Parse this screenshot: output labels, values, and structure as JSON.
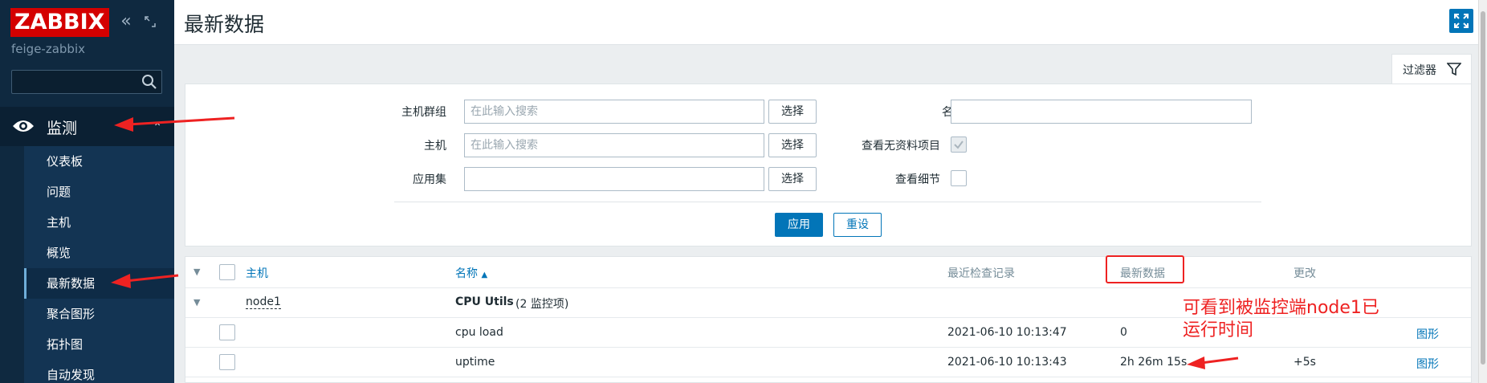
{
  "app": {
    "logo": "ZABBIX",
    "subtitle": "feige-zabbix"
  },
  "sidebar": {
    "section": "监测",
    "items": [
      {
        "label": "仪表板"
      },
      {
        "label": "问题"
      },
      {
        "label": "主机"
      },
      {
        "label": "概览"
      },
      {
        "label": "最新数据",
        "active": true
      },
      {
        "label": "聚合图形"
      },
      {
        "label": "拓扑图"
      },
      {
        "label": "自动发现"
      }
    ]
  },
  "header": {
    "title": "最新数据"
  },
  "filter": {
    "tab_label": "过滤器",
    "host_groups_label": "主机群组",
    "hosts_label": "主机",
    "applications_label": "应用集",
    "search_placeholder": "在此输入搜索",
    "select_label": "选择",
    "name_label": "名称",
    "show_without_data_label": "查看无资料项目",
    "show_details_label": "查看细节",
    "show_without_data_checked": true,
    "show_details_checked": false,
    "apply_label": "应用",
    "reset_label": "重设"
  },
  "table": {
    "columns": {
      "host": "主机",
      "name": "名称",
      "last_check": "最近检查记录",
      "last_value": "最新数据",
      "change": "更改"
    },
    "group": {
      "host": "node1",
      "app_name": "CPU Utils",
      "app_count": "(2 监控项)"
    },
    "rows": [
      {
        "name": "cpu load",
        "last_check": "2021-06-10 10:13:47",
        "last_value": "0",
        "change": "",
        "action": "图形"
      },
      {
        "name": "uptime",
        "last_check": "2021-06-10 10:13:43",
        "last_value": "2h 26m 15s",
        "change": "+5s",
        "action": "图形"
      }
    ]
  },
  "annotation": {
    "line1": "可看到被监控端node1已",
    "line2": "运行时间"
  },
  "colors": {
    "sidebar_bg": "#0f2940",
    "accent": "#0275b8",
    "logo_red": "#d40000",
    "annotation_red": "#ee2222"
  }
}
